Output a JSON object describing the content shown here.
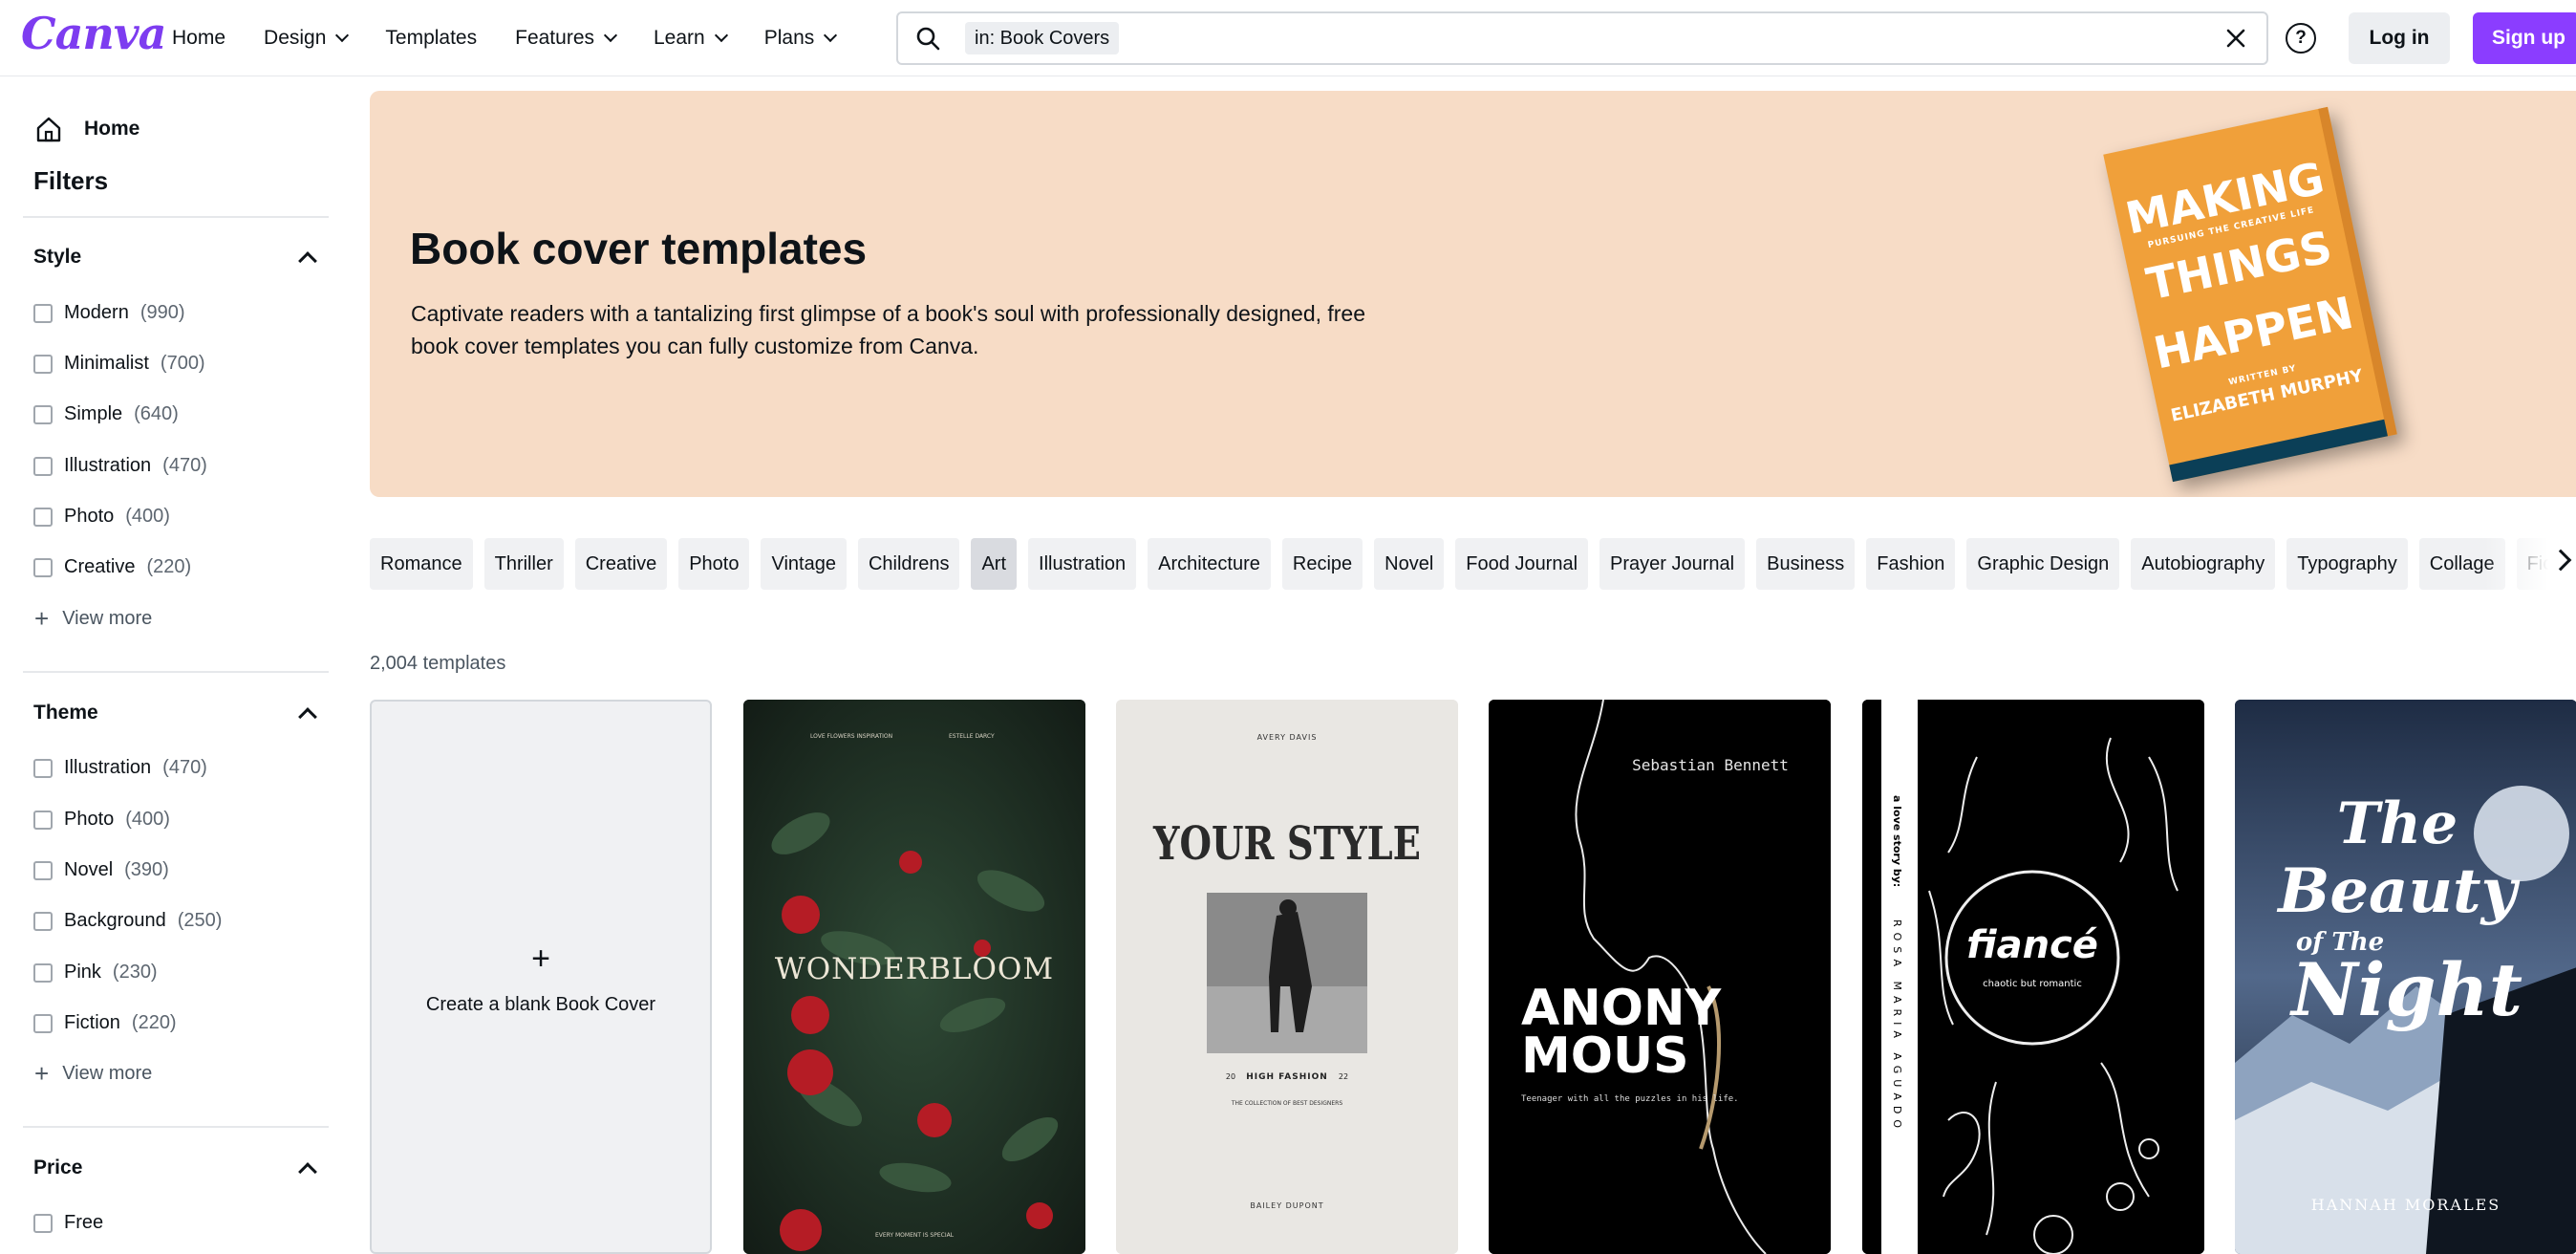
{
  "brand": {
    "logo_text": "Canva",
    "accent": "#8b3dff",
    "logo_color": "#1fa2d8"
  },
  "nav": {
    "items": [
      {
        "label": "Home",
        "dropdown": false
      },
      {
        "label": "Design",
        "dropdown": true
      },
      {
        "label": "Templates",
        "dropdown": false
      },
      {
        "label": "Features",
        "dropdown": true
      },
      {
        "label": "Learn",
        "dropdown": true
      },
      {
        "label": "Plans",
        "dropdown": true
      }
    ]
  },
  "search": {
    "chip": "in: Book Covers",
    "value": ""
  },
  "header_actions": {
    "help_icon": "question-circle-icon",
    "login": "Log in",
    "signup": "Sign up"
  },
  "sidebar": {
    "home": "Home",
    "filters_title": "Filters",
    "sections": [
      {
        "title": "Style",
        "options": [
          {
            "label": "Modern",
            "count": "(990)"
          },
          {
            "label": "Minimalist",
            "count": "(700)"
          },
          {
            "label": "Simple",
            "count": "(640)"
          },
          {
            "label": "Illustration",
            "count": "(470)"
          },
          {
            "label": "Photo",
            "count": "(400)"
          },
          {
            "label": "Creative",
            "count": "(220)"
          }
        ],
        "view_more": "View more"
      },
      {
        "title": "Theme",
        "options": [
          {
            "label": "Illustration",
            "count": "(470)"
          },
          {
            "label": "Photo",
            "count": "(400)"
          },
          {
            "label": "Novel",
            "count": "(390)"
          },
          {
            "label": "Background",
            "count": "(250)"
          },
          {
            "label": "Pink",
            "count": "(230)"
          },
          {
            "label": "Fiction",
            "count": "(220)"
          }
        ],
        "view_more": "View more"
      },
      {
        "title": "Price",
        "options": [
          {
            "label": "Free",
            "count": ""
          }
        ]
      }
    ]
  },
  "banner": {
    "title": "Book cover templates",
    "description": "Captivate readers with a tantalizing first glimpse of a book's soul with professionally designed, free book cover templates you can fully customize from Canva.",
    "book": {
      "line1": "MAKING",
      "line2": "THINGS",
      "line3": "HAPPEN",
      "tagline": "PURSUING THE CREATIVE LIFE",
      "author": "ELIZABETH MURPHY",
      "written_by": "WRITTEN BY"
    }
  },
  "categories": [
    "Romance",
    "Thriller",
    "Creative",
    "Photo",
    "Vintage",
    "Childrens",
    "Art",
    "Illustration",
    "Architecture",
    "Recipe",
    "Novel",
    "Food Journal",
    "Prayer Journal",
    "Business",
    "Fashion",
    "Graphic Design",
    "Autobiography",
    "Typography",
    "Collage",
    "Fiction"
  ],
  "active_category": "Art",
  "results": {
    "count_label": "2,004 templates"
  },
  "templates": {
    "blank": {
      "label": "Create a blank Book Cover",
      "icon": "+"
    },
    "items": [
      {
        "title": "WONDERBLOOM",
        "author": "ESTELLE DARCY",
        "top_left": "LOVE FLOWERS INSPIRATION",
        "bottom": "EVERY MOMENT IS SPECIAL"
      },
      {
        "title": "YOUR STYLE",
        "author": "AVERY DAVIS",
        "subtitle": "HIGH FASHION",
        "year_left": "20",
        "year_right": "22",
        "tagline": "THE COLLECTION OF BEST DESIGNERS",
        "bottom": "BAILEY DUPONT"
      },
      {
        "title_line1": "ANONY",
        "title_line2": "MOUS",
        "author": "Sebastian Bennett",
        "tagline": "Teenager with all the puzzles in his life."
      },
      {
        "title": "fiancé",
        "subtitle": "chaotic but romantic",
        "side_text": "a love story by:",
        "author": "ROSA MARIA AGUADO"
      },
      {
        "title_line1": "The",
        "title_line2": "Beauty",
        "title_line3": "of The",
        "title_line4": "Night",
        "author": "HANNAH MORALES"
      }
    ]
  }
}
